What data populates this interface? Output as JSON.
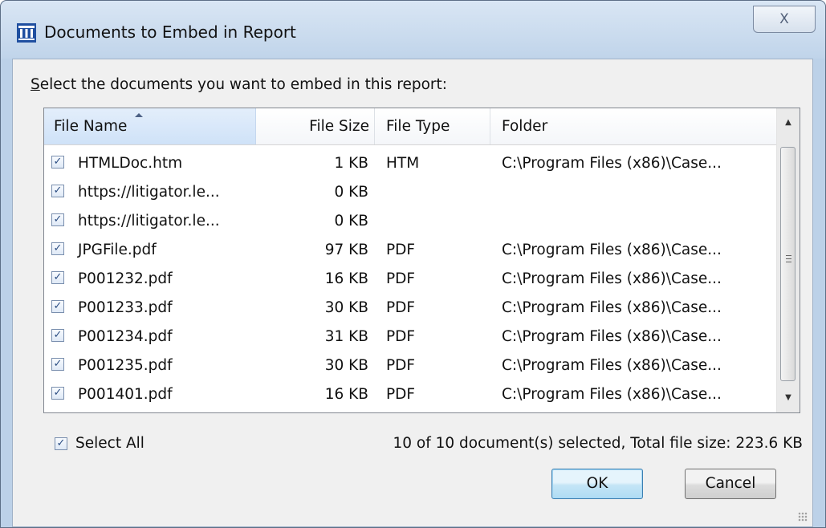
{
  "window": {
    "title": "Documents to Embed in Report",
    "close_label": "X"
  },
  "prompt": {
    "accel": "S",
    "rest": "elect the documents you want to embed in this report:"
  },
  "columns": [
    "File Name",
    "File Size",
    "File Type",
    "Folder"
  ],
  "sort": {
    "column": "File Name",
    "direction": "ascending"
  },
  "rows": [
    {
      "checked": "✓",
      "name": "HTMLDoc.htm",
      "size": "1 KB",
      "type": "HTM",
      "folder": "C:\\Program Files (x86)\\Case..."
    },
    {
      "checked": "✓",
      "name": "https://litigator.le...",
      "size": "0 KB",
      "type": "",
      "folder": ""
    },
    {
      "checked": "✓",
      "name": "https://litigator.le...",
      "size": "0 KB",
      "type": "",
      "folder": ""
    },
    {
      "checked": "✓",
      "name": "JPGFile.pdf",
      "size": "97 KB",
      "type": "PDF",
      "folder": "C:\\Program Files (x86)\\Case..."
    },
    {
      "checked": "✓",
      "name": "P001232.pdf",
      "size": "16 KB",
      "type": "PDF",
      "folder": "C:\\Program Files (x86)\\Case..."
    },
    {
      "checked": "✓",
      "name": "P001233.pdf",
      "size": "30 KB",
      "type": "PDF",
      "folder": "C:\\Program Files (x86)\\Case..."
    },
    {
      "checked": "✓",
      "name": "P001234.pdf",
      "size": "31 KB",
      "type": "PDF",
      "folder": "C:\\Program Files (x86)\\Case..."
    },
    {
      "checked": "✓",
      "name": "P001235.pdf",
      "size": "30 KB",
      "type": "PDF",
      "folder": "C:\\Program Files (x86)\\Case..."
    },
    {
      "checked": "✓",
      "name": "P001401.pdf",
      "size": "16 KB",
      "type": "PDF",
      "folder": "C:\\Program Files (x86)\\Case..."
    }
  ],
  "select_all": {
    "checked": "✓",
    "label": "Select All"
  },
  "status": "10 of 10 document(s) selected, Total file size: 223.6 KB",
  "buttons": {
    "ok": "OK",
    "cancel": "Cancel"
  },
  "icons": {
    "app": "pillar-app-icon",
    "close": "close-icon",
    "scroll_up": "scroll-up-arrow-icon",
    "scroll_down": "scroll-down-arrow-icon",
    "sort": "sort-ascending-icon",
    "size_grip": "size-grip-icon"
  },
  "colors": {
    "title_bar": "#c0d4ea",
    "client": "#f0f0f0",
    "default_button": "#c4e5f6",
    "app_icon": "#1f4fa0"
  }
}
